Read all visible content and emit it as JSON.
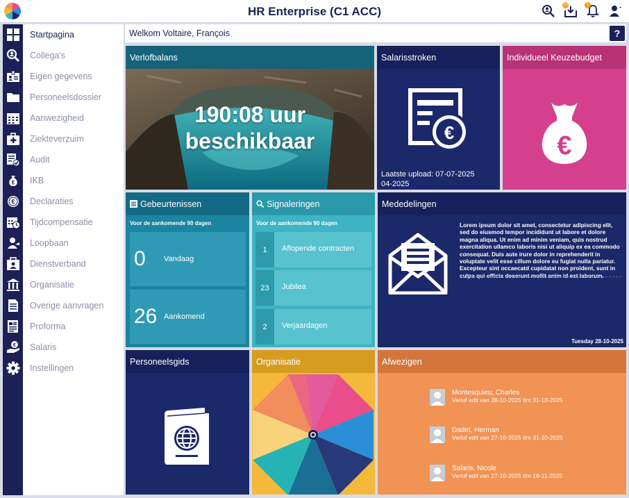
{
  "app": {
    "title": "HR Enterprise (C1 ACC)"
  },
  "top_icons": [
    {
      "icon": "search-user-icon"
    },
    {
      "icon": "inbox-download-icon",
      "badge": "10"
    },
    {
      "icon": "bell-icon",
      "badge": "1"
    },
    {
      "icon": "user-icon"
    }
  ],
  "sidebar": {
    "items": [
      {
        "label": "Startpagina",
        "icon": "grid-icon",
        "active": true
      },
      {
        "label": "Collega's",
        "icon": "search-people-icon"
      },
      {
        "label": "Eigen gegevens",
        "icon": "id-card-icon"
      },
      {
        "label": "Personeelsdossier",
        "icon": "folder-icon"
      },
      {
        "label": "Aanwezigheid",
        "icon": "calendar-icon"
      },
      {
        "label": "Ziekteverzuim",
        "icon": "medical-kit-icon"
      },
      {
        "label": "Audit",
        "icon": "audit-icon"
      },
      {
        "label": "IKB",
        "icon": "money-bag-icon"
      },
      {
        "label": "Declaraties",
        "icon": "euro-coin-icon"
      },
      {
        "label": "Tijdcompensatie",
        "icon": "calendar-clock-icon"
      },
      {
        "label": "Loopbaan",
        "icon": "career-icon"
      },
      {
        "label": "Dienstverband",
        "icon": "employment-icon"
      },
      {
        "label": "Organisatie",
        "icon": "building-icon"
      },
      {
        "label": "Overige aanvragen",
        "icon": "document-icon"
      },
      {
        "label": "Proforma",
        "icon": "proforma-icon"
      },
      {
        "label": "Salaris",
        "icon": "salary-hand-icon"
      },
      {
        "label": "Instellingen",
        "icon": "gear-icon"
      }
    ]
  },
  "welcome": {
    "text": "Welkom Voltaire, François",
    "help": "?"
  },
  "tiles": {
    "verlofbalans": {
      "title": "Verlofbalans",
      "value_line1": "190:08 uur",
      "value_line2": "beschikbaar"
    },
    "salarisstroken": {
      "title": "Salarisstroken",
      "upload": "Laatste upload: 07-07-2025",
      "period": "04-2025"
    },
    "keuzebudget": {
      "title": "Individueel Keuzebudget"
    },
    "gebeurtenissen": {
      "title": "Gebeurtenissen",
      "subtitle": "Voor de aankomende 90 dagen",
      "items": [
        {
          "count": "0",
          "label": "Vandaag"
        },
        {
          "count": "26",
          "label": "Aankomend"
        }
      ]
    },
    "signaleringen": {
      "title": "Signaleringen",
      "subtitle": "Voor de aankomende 90 dagen",
      "items": [
        {
          "count": "1",
          "label": "Aflopende contracten"
        },
        {
          "count": "23",
          "label": "Jubilea"
        },
        {
          "count": "2",
          "label": "Verjaardagen"
        }
      ]
    },
    "mededelingen": {
      "title": "Mededelingen",
      "body": "Lorem ipsum dolor sit amet, consectetur adipiscing elit, sed do eiusmod tempor incididunt ut labore et dolore magna aliqua. Ut enim ad minim veniam, quis nostrud exercitation ullamco laboris nisi ut aliquip ex ea commodo consequat. Duis aute irure dolor in reprehenderit in voluptate velit esse cillum dolore eu fugiat nulla pariatur. Excepteur sint occaecatd cupidatat non proident, sunt in culpa qui officia deserunt mollit anim id est laborum.",
      "date": "Tuesday 28-10-2025"
    },
    "personeelsgids": {
      "title": "Personeelsgids"
    },
    "organisatie": {
      "title": "Organisatie"
    },
    "afwezigen": {
      "title": "Afwezigen",
      "items": [
        {
          "name": "Montesquieu, Charles",
          "detail": "Verlof edit van 28-10-2025 t/m 31-10-2025"
        },
        {
          "name": "Dadet, Herman",
          "detail": "Verlof edit van 27-10-2025 t/m 31-10-2025"
        },
        {
          "name": "Salaris, Nicole",
          "detail": "Verlof edit van 27-10-2025 t/m 16-11-2025"
        }
      ]
    }
  },
  "colors": {
    "navy": "#1b2057",
    "navy_tile": "#1b2869",
    "teal": "#1b84a1",
    "cyan": "#3cb4c4",
    "pink": "#d4408d",
    "yellow": "#f4b93a",
    "orange": "#f09354"
  }
}
